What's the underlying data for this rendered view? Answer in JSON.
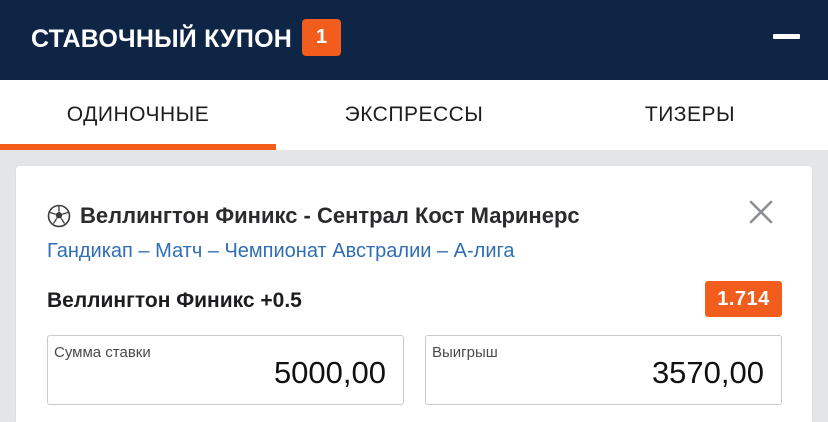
{
  "header": {
    "title": "СТАВОЧНЫЙ КУПОН",
    "count": "1"
  },
  "tabs": [
    {
      "label": "ОДИНОЧНЫЕ",
      "active": true
    },
    {
      "label": "ЭКСПРЕССЫ",
      "active": false
    },
    {
      "label": "ТИЗЕРЫ",
      "active": false
    }
  ],
  "bet": {
    "sport_icon": "soccer-ball-icon",
    "match": "Веллингтон Финикс - Сентрал Кост Маринерс",
    "market": "Гандикап – Матч – Чемпионат Австралии – А-лига",
    "selection": "Веллингтон Финикс +0.5",
    "odds": "1.714",
    "stake": {
      "label": "Сумма ставки",
      "value": "5000,00"
    },
    "win": {
      "label": "Выигрыш",
      "value": "3570,00"
    }
  },
  "colors": {
    "header_bg": "#0f2545",
    "accent": "#f25c1d",
    "link": "#2f6eb5"
  }
}
